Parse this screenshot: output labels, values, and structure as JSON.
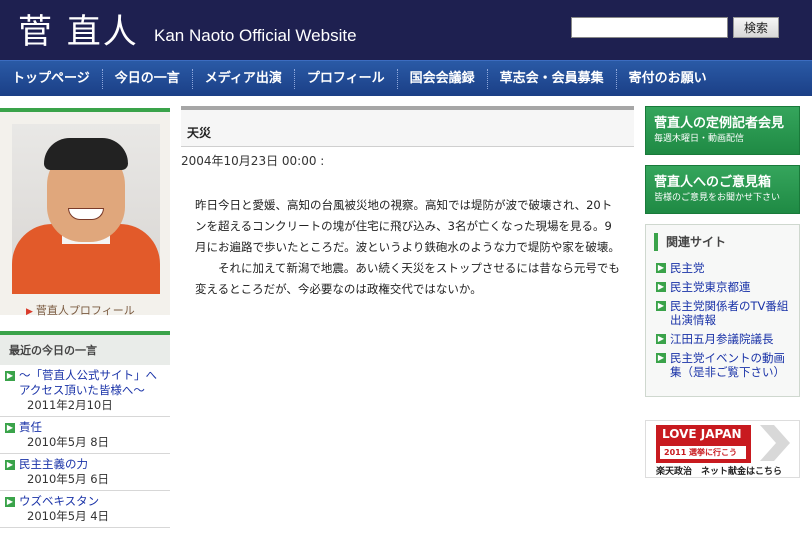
{
  "header": {
    "logo_jp": "菅 直人",
    "logo_en": "Kan Naoto Official Website",
    "search_placeholder": "",
    "search_button": "検索"
  },
  "nav": [
    "トップページ",
    "今日の一言",
    "メディア出演",
    "プロフィール",
    "国会会議録",
    "草志会・会員募集",
    "寄付のお願い"
  ],
  "profile": {
    "link": "菅直人プロフィール"
  },
  "recent": {
    "title": "最近の今日の一言",
    "items": [
      {
        "title": "〜「菅直人公式サイト」へアクセス頂いた皆様へ〜",
        "date": "2011年2月10日"
      },
      {
        "title": "責任",
        "date": "2010年5月 8日"
      },
      {
        "title": "民主主義の力",
        "date": "2010年5月 6日"
      },
      {
        "title": "ウズベキスタン",
        "date": "2010年5月 4日"
      }
    ]
  },
  "article": {
    "title": "天災",
    "date": "2004年10月23日 00:00 :",
    "p1": "昨日今日と愛媛、高知の台風被災地の視察。高知では堤防が波で破壊され、20トンを超えるコンクリートの塊が住宅に飛び込み、3名が亡くなった現場を見る。9月にお遍路で歩いたところだ。波というより鉄砲水のような力で堤防や家を破壊。",
    "p2": "それに加えて新潟で地震。あい続く天災をストップさせるには昔なら元号でも変えるところだが、今必要なのは政権交代ではないか。"
  },
  "sidebar": {
    "btn1_big": "菅直人の定例記者会見",
    "btn1_small": "毎週木曜日・動画配信",
    "btn2_big": "菅直人へのご意見箱",
    "btn2_small": "皆様のご意見をお聞かせ下さい",
    "related_title": "関連サイト",
    "related": [
      "民主党",
      "民主党東京都連",
      "民主党関係者のTV番組出演情報",
      "江田五月参議院議長",
      "民主党イベントの動画集（是非ご覧下さい）"
    ],
    "banner_top": "LOVE JAPAN",
    "banner_sub": "2011 選挙に行こう",
    "banner_caption": "楽天政治　ネット献金はこちら"
  },
  "colors": {
    "header_bg": "#1e2050",
    "nav_bg": "#2a5aa6",
    "accent_green": "#3aa34a",
    "link_blue": "#1a33a8"
  }
}
